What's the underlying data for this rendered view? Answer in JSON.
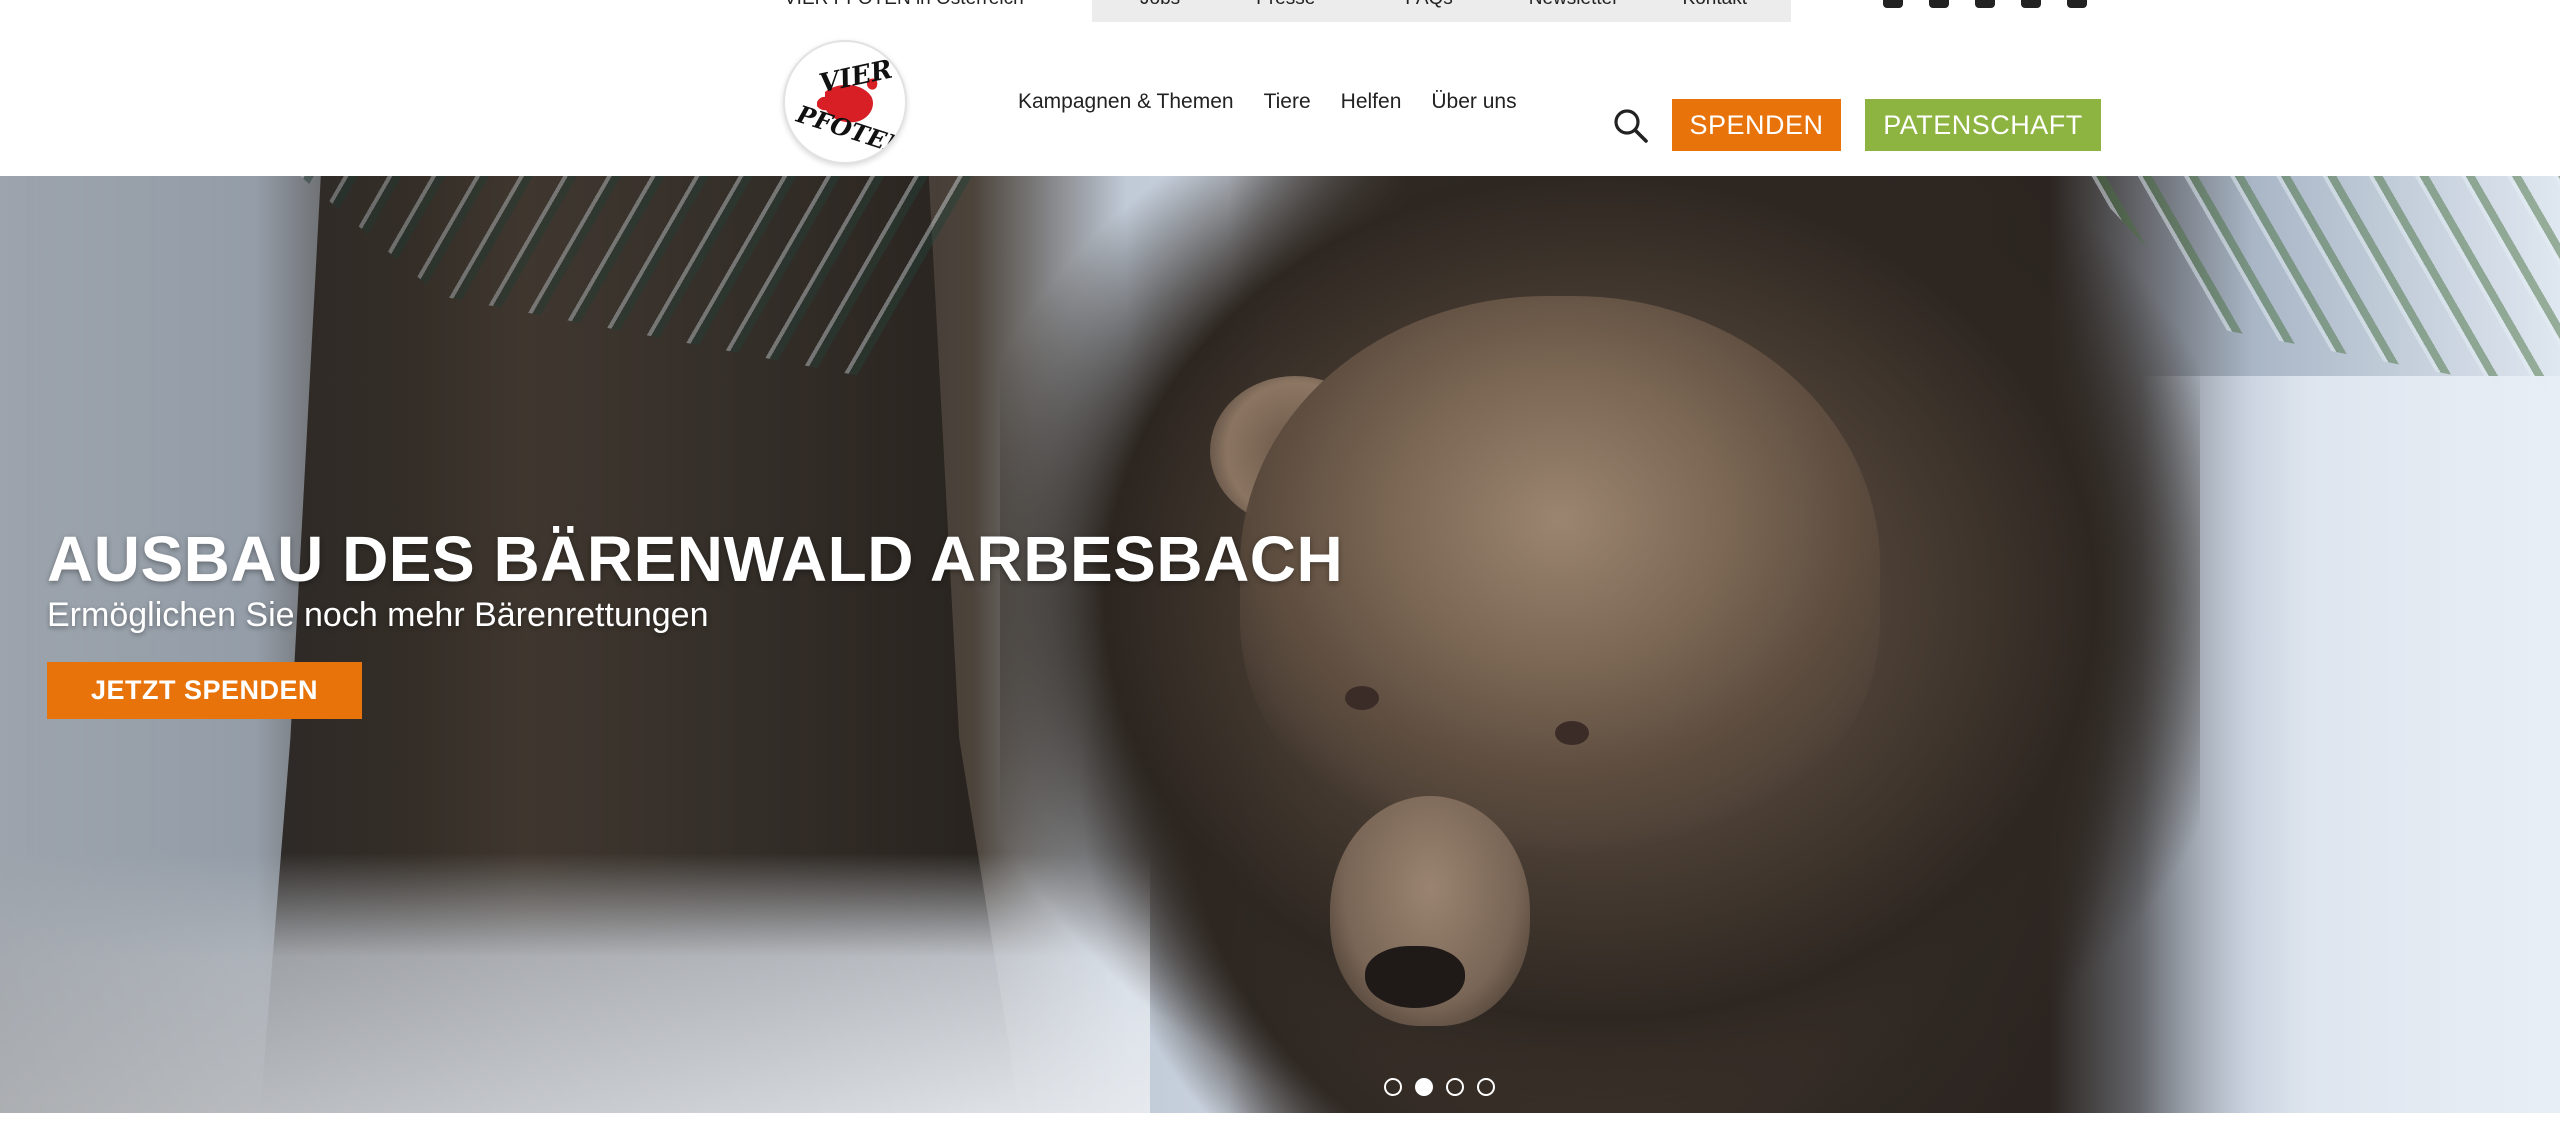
{
  "topbar": {
    "country": "VIER PFOTEN in Österreich",
    "utility_nav": [
      "Jobs",
      "Presse",
      "FAQs",
      "Newsletter",
      "Kontakt"
    ],
    "social_icons": [
      "instagram-icon",
      "facebook-icon",
      "twitter-icon",
      "linkedin-icon",
      "youtube-icon"
    ]
  },
  "header": {
    "logo_text_top": "VIER",
    "logo_text_bottom": "PFOTEN",
    "nav": [
      "Kampagnen & Themen",
      "Tiere",
      "Helfen",
      "Über uns"
    ],
    "search_icon": "search-icon",
    "spenden_label": "SPENDEN",
    "patenschaft_label": "PATENSCHAFT"
  },
  "hero": {
    "title": "AUSBAU DES BÄRENWALD ARBESBACH",
    "subtitle": "Ermöglichen Sie noch mehr Bärenrettungen",
    "cta_label": "JETZT SPENDEN",
    "slide_count": 4,
    "active_slide": 2
  },
  "colors": {
    "accent_orange": "#e8730a",
    "accent_green": "#8db441"
  }
}
